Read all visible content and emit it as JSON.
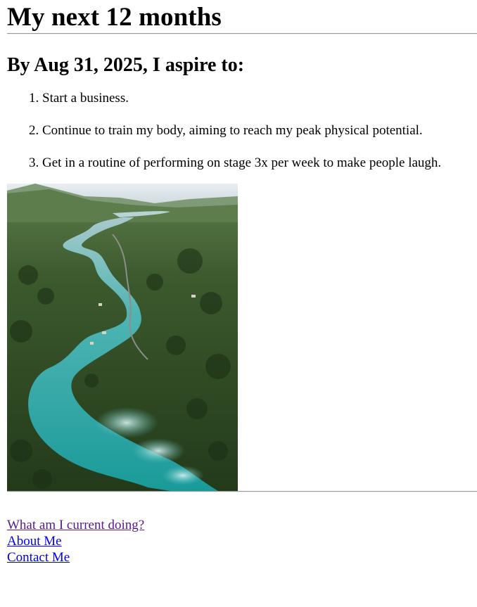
{
  "page": {
    "title": "My next 12 months",
    "aspiration_heading": "By Aug 31, 2025, I aspire to:",
    "goals": [
      "Start a business.",
      "Continue to train my body, aiming to reach my peak physical potential.",
      "Get in a routine of performing on stage 3x per week to make people laugh."
    ],
    "image": {
      "subject": "aerial view of turquoise river through forest"
    },
    "nav_links": [
      "What am I current doing?",
      "About Me",
      "Contact Me"
    ]
  },
  "colors": {
    "visited_link": "#551a8b",
    "unvisited_link": "#0000ee",
    "river": "#2aa5a3",
    "forest": "#2f4a24"
  }
}
